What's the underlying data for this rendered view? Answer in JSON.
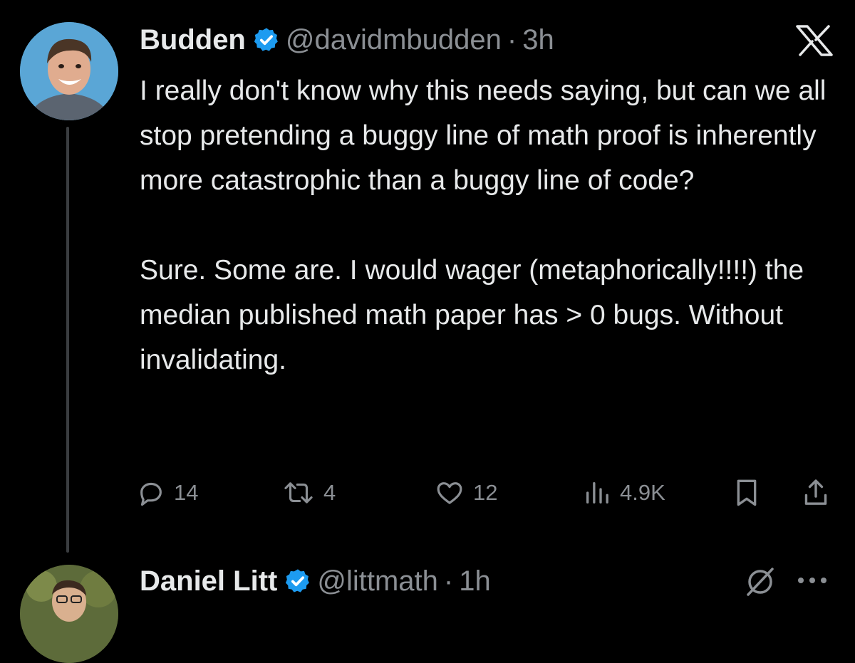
{
  "tweet": {
    "author_name": "Budden",
    "handle": "@davidmbudden",
    "separator": "·",
    "time": "3h",
    "text": "I really don't know why this needs saying, but can we all stop pretending a buggy line of math proof is inherently more catastrophic than a buggy line of code?\n\nSure. Some are. I would wager (metaphorically!!!!) the median published math paper has > 0 bugs. Without invalidating.",
    "replies": "14",
    "retweets": "4",
    "likes": "12",
    "views": "4.9K"
  },
  "reply": {
    "author_name": "Daniel Litt",
    "handle": "@littmath",
    "separator": "·",
    "time": "1h"
  },
  "icons": {
    "verified": "verified-badge-icon",
    "brand": "x-logo-icon",
    "reply": "reply-icon",
    "retweet": "retweet-icon",
    "like": "heart-icon",
    "views": "views-icon",
    "bookmark": "bookmark-icon",
    "share": "share-icon",
    "mute": "mute-icon",
    "more": "more-icon"
  },
  "colors": {
    "background": "#000000",
    "text": "#e7e9ea",
    "secondary": "#8b8f94",
    "verified": "#1d9bf0"
  }
}
